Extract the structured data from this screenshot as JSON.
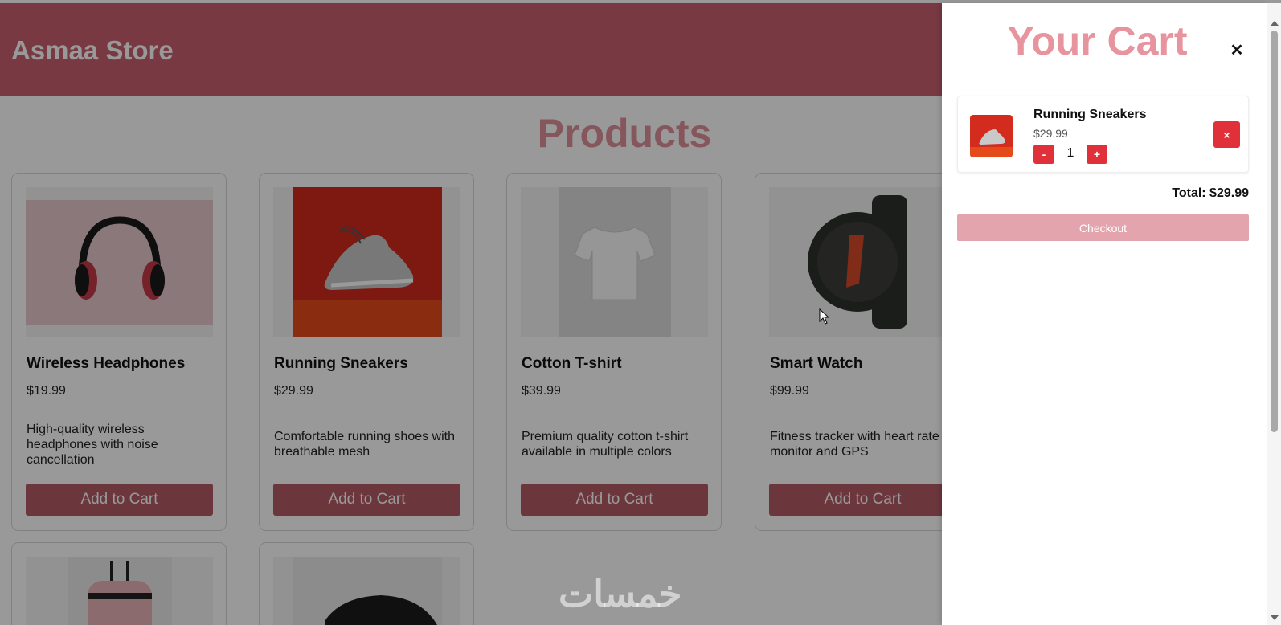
{
  "store": {
    "brand": "Asmaa Store",
    "products_title": "Products",
    "add_to_cart_label": "Add to Cart",
    "products": [
      {
        "name": "Wireless Headphones",
        "price": "$19.99",
        "description": "High-quality wireless headphones with noise cancellation",
        "image": "headphones-image"
      },
      {
        "name": "Running Sneakers",
        "price": "$29.99",
        "description": "Comfortable running shoes with breathable mesh",
        "image": "sneakers-image"
      },
      {
        "name": "Cotton T-shirt",
        "price": "$39.99",
        "description": "Premium quality cotton t-shirt available in multiple colors",
        "image": "tshirt-image"
      },
      {
        "name": "Smart Watch",
        "price": "$99.99",
        "description": "Fitness tracker with heart rate monitor and GPS",
        "image": "smartwatch-image"
      }
    ],
    "partial_products": [
      {
        "image": "backpack-image"
      },
      {
        "image": "mouse-image"
      }
    ]
  },
  "cart": {
    "title": "Your Cart",
    "close_icon": "close-icon",
    "items": [
      {
        "name": "Running Sneakers",
        "price": "$29.99",
        "quantity": "1",
        "minus_label": "-",
        "plus_label": "+",
        "remove_label": "×"
      }
    ],
    "total": "Total: $29.99",
    "checkout_label": "Checkout"
  },
  "watermark": "خمسات",
  "colors": {
    "header": "#c9606e",
    "accent": "#e8949f",
    "button": "#b55b66",
    "danger": "#e0303a",
    "checkout": "#e3a4ad"
  }
}
